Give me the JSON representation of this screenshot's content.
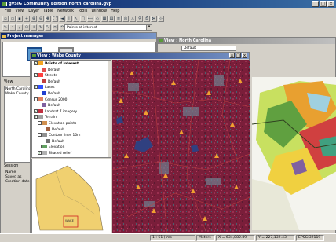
{
  "app": {
    "title": "gvSIG Community Edition:north_carolina.gvp"
  },
  "menu": [
    "File",
    "View",
    "Layer",
    "Table",
    "Network",
    "Tools",
    "Window",
    "Help"
  ],
  "toolbar": {
    "combo_value": "Points of interest"
  },
  "project_manager": {
    "title": "Project manager",
    "view_label": "View",
    "views": [
      "North Carolina",
      "Wake County"
    ],
    "session": {
      "label": "Session",
      "name": "Name",
      "saved_as": "Saved as",
      "creation_date": "Creation date"
    }
  },
  "view_nc": {
    "title": "View : North Carolina",
    "combo": "Default"
  },
  "view_wake": {
    "title": "View : Wake County",
    "map_label": "WAKE"
  },
  "toc": [
    {
      "label": "Points of interest",
      "bold": true,
      "checked": true,
      "color": "#f5a623"
    },
    {
      "label": "Default",
      "indent": 2,
      "color": "#e05050"
    },
    {
      "label": "Streets",
      "checked": true,
      "color": "#ff4040"
    },
    {
      "label": "Default",
      "indent": 2,
      "color": "#c04040"
    },
    {
      "label": "Lakes",
      "checked": true,
      "color": "#3050ff"
    },
    {
      "label": "Default",
      "indent": 2,
      "color": "#2040d0"
    },
    {
      "label": "Census 2000",
      "checked": false,
      "color": "#e08060"
    },
    {
      "label": "Default",
      "indent": 2,
      "color": "#8060a0"
    },
    {
      "label": "Landsat 7 imagery",
      "checked": true,
      "color": "#c03040"
    },
    {
      "label": "Terrain",
      "checked": true,
      "color": "#a0a0a0"
    },
    {
      "label": "Elevation points",
      "checked": false,
      "indent": 1,
      "color": "#d09050"
    },
    {
      "label": "Default",
      "indent": 3,
      "color": "#a06040"
    },
    {
      "label": "Contour lines 10m",
      "checked": false,
      "indent": 1,
      "color": "#909090"
    },
    {
      "label": "Default",
      "indent": 3,
      "color": "#707070"
    },
    {
      "label": "Elevation",
      "checked": false,
      "indent": 1,
      "color": "#60a060"
    },
    {
      "label": "Shaded relief",
      "checked": true,
      "indent": 1,
      "color": "#b0b0b0"
    }
  ],
  "status": {
    "scale": "1 : 61 (.ms",
    "units": "Meters",
    "x": "X = 634,882.89",
    "y": "Y = 227,132.43",
    "epsg": "EPSG:32119"
  },
  "colors": {
    "title_active": "#0a246a",
    "satellite_base": "#7a1e3a"
  }
}
